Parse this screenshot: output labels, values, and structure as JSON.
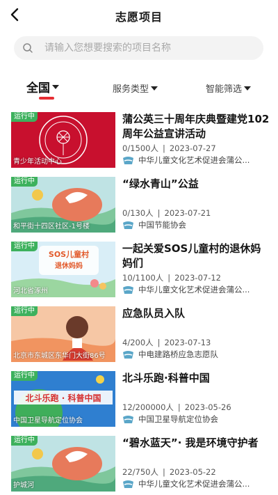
{
  "header": {
    "title": "志愿项目"
  },
  "search": {
    "placeholder": "请输入您想要搜索的项目名称"
  },
  "filters": {
    "region": "全国",
    "service_type": "服务类型",
    "smart_filter": "智能筛选"
  },
  "colors": {
    "accent": "#e62d33",
    "status_green": "#3db15d"
  },
  "projects": [
    {
      "status": "运行中",
      "location": "青少年活动中心",
      "title": "蒲公英三十周年庆典暨建党102周年公益宣讲活动",
      "count": "0/1500人",
      "date": "2023-07-27",
      "org": "中华儿童文化艺术促进会蒲公..."
    },
    {
      "status": "运行中",
      "location": "和平街十四区社区-1号楼",
      "title": "“绿水青山”公益",
      "count": "0/130人",
      "date": "2023-07-21",
      "org": "中国节能协会"
    },
    {
      "status": "运行中",
      "location": "河北省涿州",
      "title": "一起关爱SOS儿童村的退休妈妈们",
      "count": "10/1100人",
      "date": "2023-07-12",
      "org": "中华儿童文化艺术促进会蒲公..."
    },
    {
      "status": "运行中",
      "location": "北京市东城区东华门大街86号",
      "title": "应急队员入队",
      "count": "4/200人",
      "date": "2023-07-13",
      "org": "中电建路桥应急志愿队"
    },
    {
      "status": "运行中",
      "location": "中国卫星导航定位协会",
      "title": "北斗乐跑·科普中国",
      "count": "12/200000人",
      "date": "2023-05-26",
      "org": "中国卫星导航定位协会"
    },
    {
      "status": "运行中",
      "location": "护城河",
      "title": "“碧水蓝天”· 我是环境守护者",
      "count": "22/750人",
      "date": "2023-05-22",
      "org": "中华儿童文化艺术促进会蒲公..."
    }
  ],
  "thumb_text": {
    "sos_line1": "SOS儿童村",
    "sos_line2": "退休妈妈",
    "beidou": "北斗乐跑 · 科普中国"
  }
}
